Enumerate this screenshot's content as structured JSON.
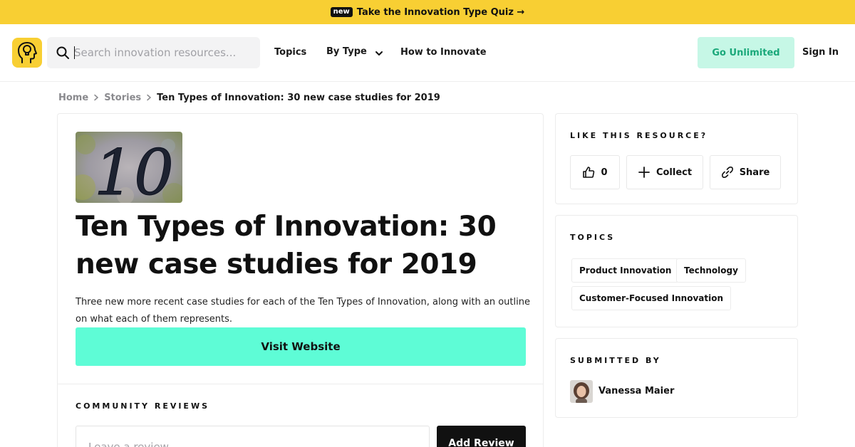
{
  "banner": {
    "badge": "new",
    "text": "Take the Innovation Type Quiz →"
  },
  "header": {
    "logo_icon": "lightbulb-head-icon",
    "search_placeholder": "Search innovation resources...",
    "nav": {
      "topics": "Topics",
      "by_type": "By Type",
      "how_to": "How to Innovate"
    },
    "go_unlimited": "Go Unlimited",
    "sign_in": "Sign In"
  },
  "breadcrumb": {
    "home": "Home",
    "stories": "Stories",
    "current": "Ten Types of Innovation: 30 new case studies for 2019"
  },
  "article": {
    "title": "Ten Types of Innovation: 30 new case studies for 2019",
    "description": "Three new more recent case studies for each of the Ten Types of Innovation, along with an outline on what each of them represents.",
    "visit_label": "Visit Website",
    "thumbnail_text": "10"
  },
  "reviews": {
    "label": "COMMUNITY REVIEWS",
    "placeholder": "Leave a review...",
    "add_label": "Add Review"
  },
  "sidebar": {
    "like": {
      "label": "LIKE THIS RESOURCE?",
      "likes": "0",
      "collect": "Collect",
      "share": "Share"
    },
    "topics": {
      "label": "TOPICS",
      "items": [
        "Product Innovation",
        "Technology",
        "Customer-Focused Innovation"
      ]
    },
    "submitted": {
      "label": "SUBMITTED BY",
      "name": "Vanessa Maier"
    }
  },
  "colors": {
    "banner": "#f8cf33",
    "accent": "#5efcd6",
    "unlimited_bg": "#c6f7e6",
    "unlimited_text": "#1aa87a"
  }
}
